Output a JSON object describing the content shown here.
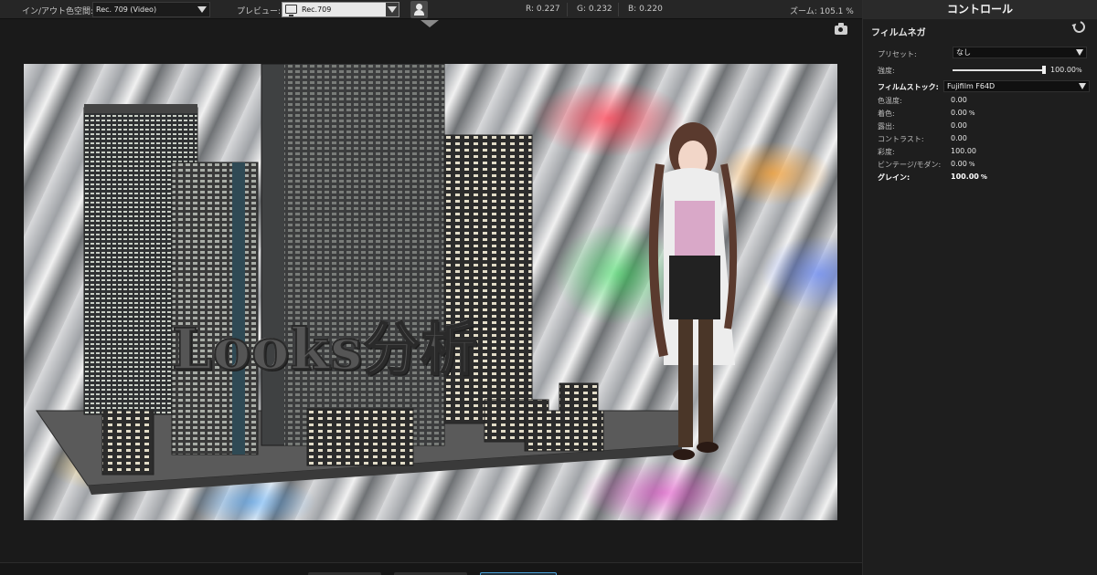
{
  "toolbar": {
    "inout_label": "イン/アウト色空間:",
    "inout_value": "Rec. 709 (Video)",
    "preview_label": "プレビュー:",
    "preview_value": "Rec.709",
    "r_label": "R:",
    "r_value": "0.227",
    "g_label": "G:",
    "g_value": "0.232",
    "b_label": "B:",
    "b_value": "0.220",
    "zoom_label": "ズーム:",
    "zoom_value": "105.1",
    "zoom_unit": "%"
  },
  "preview": {
    "title_text": "Looks分析"
  },
  "panel": {
    "header": "コントロール",
    "section": "フィルムネガ",
    "preset_label": "プリセット:",
    "preset_value": "なし",
    "strength_label": "強度:",
    "strength_value": "100.00",
    "strength_unit": "%",
    "strength_fraction": 1.0,
    "stock_label": "フィルムストック:",
    "stock_value": "Fujifilm F64D",
    "params": [
      {
        "label": "色温度:",
        "value": "0.00",
        "unit": ""
      },
      {
        "label": "着色:",
        "value": "0.00",
        "unit": "%"
      },
      {
        "label": "露出:",
        "value": "0.00",
        "unit": ""
      },
      {
        "label": "コントラスト:",
        "value": "0.00",
        "unit": ""
      },
      {
        "label": "彩度:",
        "value": "100.00",
        "unit": ""
      },
      {
        "label": "ビンテージ/モダン:",
        "value": "0.00",
        "unit": "%"
      },
      {
        "label": "グレイン:",
        "value": "100.00",
        "unit": "%"
      }
    ]
  },
  "icons": {
    "reset": "reset-icon",
    "camera": "camera-icon",
    "person": "person-icon",
    "monitor": "monitor-icon"
  },
  "colors": {
    "accent": "#4aa0d8"
  }
}
